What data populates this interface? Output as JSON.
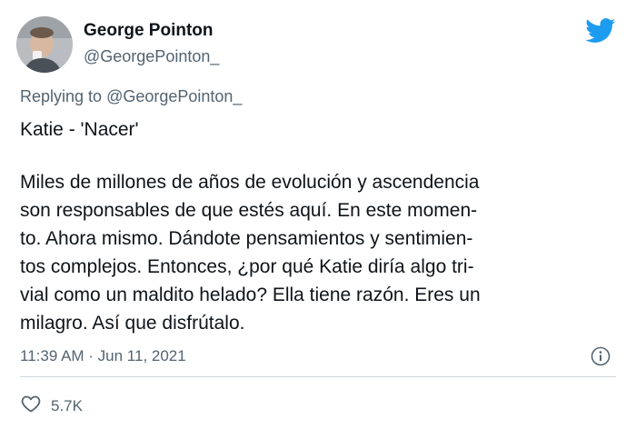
{
  "author": {
    "name": "George Pointon",
    "handle": "@GeorgePointon_"
  },
  "reply": {
    "prefix": "Replying to ",
    "mention": "@GeorgePointon_"
  },
  "tweet": {
    "title": "Katie - 'Nacer'",
    "lines": [
      "Miles de millones de años de evolución y ascendencia",
      "son responsables de que estés aquí.  En este momen-",
      "to. Ahora mismo. Dándote pensamientos y sentimien-",
      "tos complejos. Entonces, ¿por qué Katie diría algo tri-",
      "vial como un maldito helado? Ella tiene razón. Eres un",
      "milagro. Así que disfrútalo."
    ]
  },
  "meta": {
    "timestamp": "11:39 AM · Jun 11, 2021"
  },
  "actions": {
    "likes": "5.7K"
  },
  "icons": {
    "bird": "twitter-bird-icon",
    "info": "info-icon",
    "like": "heart-icon"
  },
  "colors": {
    "brand": "#1d9bf0",
    "text": "#0f1419",
    "secondary": "#536471",
    "divider": "#cfd9de"
  }
}
